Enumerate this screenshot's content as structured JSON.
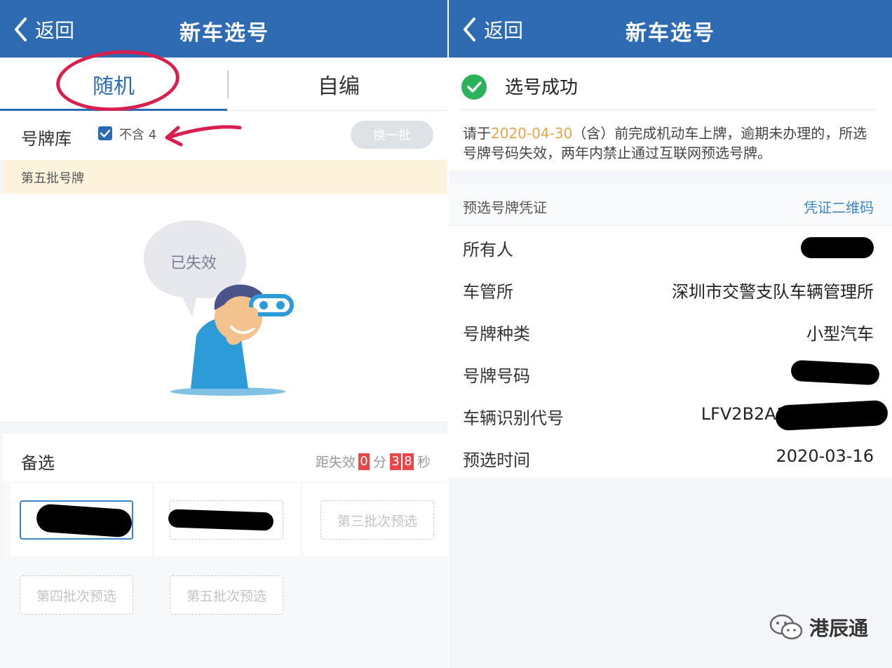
{
  "left": {
    "nav": {
      "back_label": "返回",
      "title": "新车选号"
    },
    "tabs": [
      {
        "label": "随机"
      },
      {
        "label": "自编"
      }
    ],
    "pool": {
      "label": "号牌库",
      "exclude_four_label": "不含 4",
      "exclude_four_checked": true,
      "swap_label": "换一批"
    },
    "batch_banner": "第五批号牌",
    "illustration": {
      "bubble_text": "已失效"
    },
    "backup": {
      "title": "备选",
      "countdown": {
        "prefix": "距失效",
        "minutes": "0",
        "min_unit": "分",
        "sec_tens": "3",
        "sec_ones": "8",
        "sec_unit": "秒"
      },
      "slots": [
        {
          "label": "",
          "selected": true
        },
        {
          "label": "",
          "selected": false
        },
        {
          "label": "第三批次预选",
          "selected": false
        },
        {
          "label": "第四批次预选",
          "selected": false
        },
        {
          "label": "第五批次预选",
          "selected": false
        }
      ]
    }
  },
  "right": {
    "nav": {
      "back_label": "返回",
      "title": "新车选号"
    },
    "success": {
      "text": "选号成功",
      "notice_prefix": "请于",
      "notice_date": "2020-04-30",
      "notice_suffix": "（含）前完成机动车上牌，逾期未办理的，所选号牌号码失效，两年内禁止通过互联网预选号牌。"
    },
    "certificate": {
      "title": "预选号牌凭证",
      "qr_link": "凭证二维码",
      "rows": [
        {
          "key": "所有人",
          "value": ""
        },
        {
          "key": "车管所",
          "value": "深圳市交警支队车辆管理所"
        },
        {
          "key": "号牌种类",
          "value": "小型汽车"
        },
        {
          "key": "号牌号码",
          "value": ""
        },
        {
          "key": "车辆识别代号",
          "value": "LFV2B2A1"
        },
        {
          "key": "预选时间",
          "value": "2020-03-16"
        }
      ]
    }
  },
  "watermark": {
    "text": "港辰通"
  },
  "colors": {
    "nav_bg": "#2f6bb3",
    "accent": "#2f6bb3",
    "warning_date": "#e1a54a",
    "countdown_digit": "#e8474a",
    "annotation_red": "#d91f4e",
    "link": "#3d86c6"
  }
}
